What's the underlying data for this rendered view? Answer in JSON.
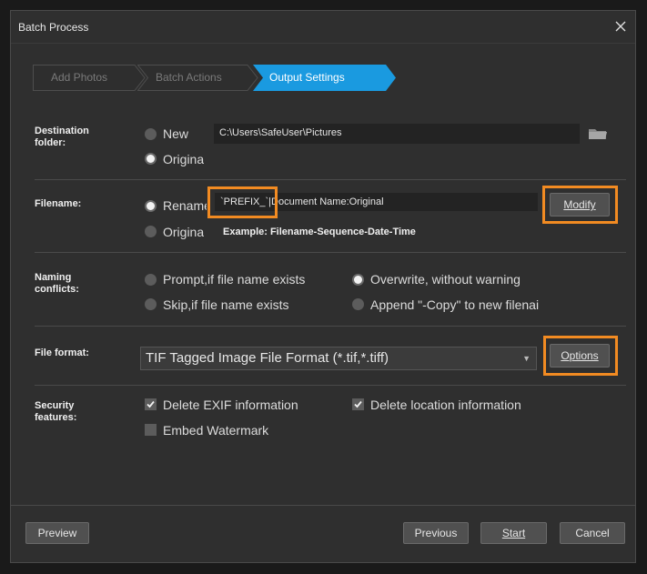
{
  "window": {
    "title": "Batch Process"
  },
  "steps": [
    {
      "label": "Add Photos",
      "active": false
    },
    {
      "label": "Batch Actions",
      "active": false
    },
    {
      "label": "Output Settings",
      "active": true
    }
  ],
  "destination": {
    "label": "Destination folder:",
    "label_line1": "Destination",
    "label_line2": "folder:",
    "new_label": "New",
    "original_label": "Origina",
    "selected": "original",
    "path": "C:\\Users\\SafeUser\\Pictures",
    "browse_icon": "folder-icon"
  },
  "filename": {
    "label": "Filename:",
    "rename_label": "Rename",
    "original_label": "Origina",
    "selected": "rename",
    "pattern": "`PREFIX_`|Document Name:Original",
    "example": "Example: Filename-Sequence-Date-Time",
    "modify_button": "Modify"
  },
  "naming_conflicts": {
    "label_line1": "Naming",
    "label_line2": "conflicts:",
    "options": [
      {
        "label": "Prompt,if file name exists",
        "selected": false
      },
      {
        "label": "Overwrite, without warning",
        "selected": true
      },
      {
        "label": "Skip,if file name exists",
        "selected": false
      },
      {
        "label": "Append \"-Copy\" to new filenai",
        "selected": false
      }
    ]
  },
  "file_format": {
    "label": "File format:",
    "value": "TIF Tagged Image File Format (*.tif,*.tiff)",
    "options_button": "Options"
  },
  "security": {
    "label_line1": "Security",
    "label_line2": "features:",
    "delete_exif": {
      "label": "Delete EXIF information",
      "checked": true
    },
    "delete_location": {
      "label": "Delete location information",
      "checked": true
    },
    "embed_watermark": {
      "label": "Embed Watermark",
      "checked": false
    }
  },
  "footer": {
    "preview": "Preview",
    "previous": "Previous",
    "start": "Start",
    "cancel": "Cancel"
  },
  "colors": {
    "accent_step": "#1a9ae0",
    "highlight": "#f28b22"
  }
}
